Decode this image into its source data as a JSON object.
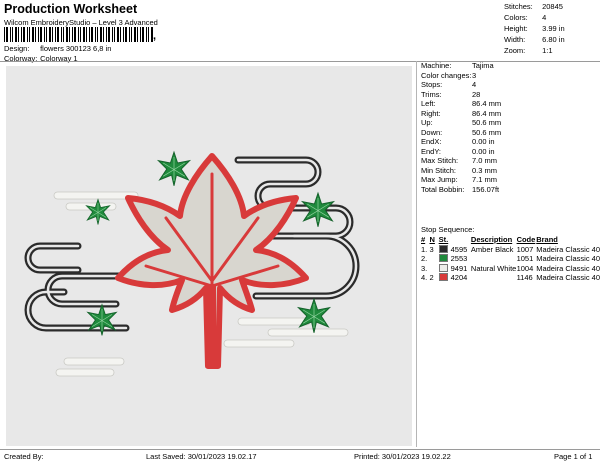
{
  "header": {
    "title": "Production Worksheet",
    "subtitle": "Wilcom EmbroideryStudio – Level 3 Advanced",
    "barcode_suffix": ","
  },
  "design_info": {
    "design_label": "Design:",
    "design_value": "flowers 300123 6,8 in",
    "colorway_label": "Colorway:",
    "colorway_value": "Colorway 1"
  },
  "summary": {
    "stitches_label": "Stitches:",
    "stitches": "20845",
    "colors_label": "Colors:",
    "colors": "4",
    "height_label": "Height:",
    "height": "3.99 in",
    "width_label": "Width:",
    "width": "6.80 in",
    "zoom_label": "Zoom:",
    "zoom": "1:1"
  },
  "details": [
    {
      "label": "Machine:",
      "value": "Tajima"
    },
    {
      "label": "Color changes:",
      "value": "3"
    },
    {
      "label": "Stops:",
      "value": "4"
    },
    {
      "label": "Trims:",
      "value": "28"
    },
    {
      "label": "Left:",
      "value": "86.4 mm"
    },
    {
      "label": "Right:",
      "value": "86.4 mm"
    },
    {
      "label": "Up:",
      "value": "50.6 mm"
    },
    {
      "label": "Down:",
      "value": "50.6 mm"
    },
    {
      "label": "EndX:",
      "value": "0.00 in"
    },
    {
      "label": "EndY:",
      "value": "0.00 in"
    },
    {
      "label": "Max Stitch:",
      "value": "7.0 mm"
    },
    {
      "label": "Min Stitch:",
      "value": "0.3 mm"
    },
    {
      "label": "Max Jump:",
      "value": "7.1 mm"
    },
    {
      "label": "Total Bobbin:",
      "value": "156.07ft"
    }
  ],
  "stop_sequence": {
    "title": "Stop Sequence:",
    "headers": [
      "#",
      "N",
      "St.",
      "Description",
      "Code",
      "Brand"
    ],
    "rows": [
      {
        "num": "1.",
        "n": "3",
        "st": "4595",
        "description": "Amber Black",
        "code": "1007",
        "brand": "Madeira Classic 40",
        "color": "#2b2b2b"
      },
      {
        "num": "2.",
        "n": "",
        "st": "2553",
        "description": "",
        "code": "1051",
        "brand": "Madeira Classic 40",
        "color": "#1f8a3c"
      },
      {
        "num": "3.",
        "n": "",
        "st": "9491",
        "description": "Natural White",
        "code": "1004",
        "brand": "Madeira Classic 40",
        "color": "#ededea"
      },
      {
        "num": "4.",
        "n": "2",
        "st": "4204",
        "description": "",
        "code": "1146",
        "brand": "Madeira Classic 40",
        "color": "#d83a3a"
      }
    ]
  },
  "footer": {
    "created": "Created By:",
    "last_saved": "Last Saved: 30/01/2023 19.02.17",
    "printed": "Printed: 30/01/2023 19.02.22",
    "page": "Page 1 of 1"
  },
  "design_colors": {
    "background": "#e8e8e8",
    "black": "#2b2b2b",
    "green": "#1f8a3c",
    "white": "#ededea",
    "red": "#d83a3a"
  }
}
